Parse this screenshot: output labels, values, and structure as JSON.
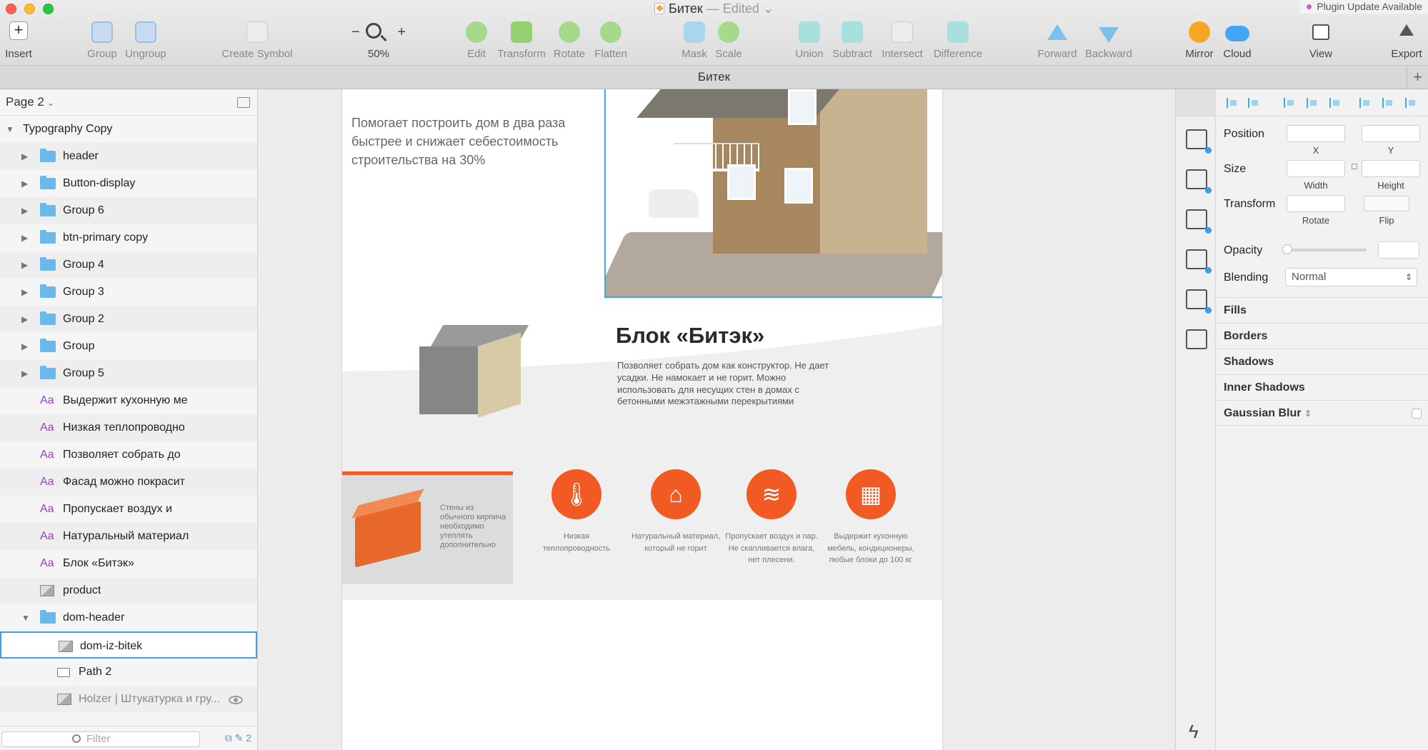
{
  "window": {
    "doc_name": "Битек",
    "doc_status": "— Edited",
    "plugin_badge": "Plugin Update Available",
    "tab_title": "Битек",
    "tab_add": "+"
  },
  "toolbar": {
    "insert": "Insert",
    "group": "Group",
    "ungroup": "Ungroup",
    "create_symbol": "Create Symbol",
    "zoom_minus": "−",
    "zoom_plus": "+",
    "zoom_level": "50%",
    "edit": "Edit",
    "transform": "Transform",
    "rotate": "Rotate",
    "flatten": "Flatten",
    "mask": "Mask",
    "scale": "Scale",
    "union": "Union",
    "subtract": "Subtract",
    "intersect": "Intersect",
    "difference": "Difference",
    "forward": "Forward",
    "backward": "Backward",
    "mirror": "Mirror",
    "cloud": "Cloud",
    "view": "View",
    "export": "Export"
  },
  "layers": {
    "page": "Page 2",
    "root": "Typography Copy",
    "items": [
      {
        "type": "folder",
        "name": "header"
      },
      {
        "type": "folder",
        "name": "Button-display"
      },
      {
        "type": "folder",
        "name": "Group 6"
      },
      {
        "type": "folder",
        "name": "btn-primary copy"
      },
      {
        "type": "folder",
        "name": "Group 4"
      },
      {
        "type": "folder",
        "name": "Group 3"
      },
      {
        "type": "folder",
        "name": "Group 2"
      },
      {
        "type": "folder",
        "name": "Group"
      },
      {
        "type": "folder",
        "name": "Group 5"
      },
      {
        "type": "text",
        "name": "Выдержит кухонную ме"
      },
      {
        "type": "text",
        "name": "Низкая теплопроводно"
      },
      {
        "type": "text",
        "name": "Позволяет собрать до"
      },
      {
        "type": "text",
        "name": "Фасад можно покрасит"
      },
      {
        "type": "text",
        "name": "Пропускает воздух и"
      },
      {
        "type": "text",
        "name": "Натуральный материал"
      },
      {
        "type": "text",
        "name": "Блок «Битэк»"
      },
      {
        "type": "image",
        "name": "product"
      },
      {
        "type": "folder",
        "name": "dom-header"
      },
      {
        "type": "image",
        "name": "dom-iz-bitek"
      },
      {
        "type": "shape",
        "name": "Path 2"
      },
      {
        "type": "image",
        "name": "Holzer | Штукатурка и гру..."
      }
    ],
    "filter_placeholder": "Filter",
    "filter_count": "2"
  },
  "canvas": {
    "hero_text": "Помогает построить дом в два раза быстрее и снижает себестоимость строительства на 30%",
    "block_title": "Блок «Битэк»",
    "block_desc": "Позволяет собрать дом как конструктор. Не дает усадки. Не намокает и не горит. Можно использовать для несущих стен в домах с бетонными межэтажными перекрытиями",
    "brick_text": "Стены из обычного кирпича необходимо утеплять дополнительно",
    "accent_color": "#f15a22",
    "features": [
      {
        "icon": "thermometer-icon",
        "text": "Низкая теплопроводность"
      },
      {
        "icon": "house-icon",
        "text": "Натуральный материал, который не горит"
      },
      {
        "icon": "air-waves-icon",
        "text": "Пропускает воздух и пар. Не скапливается влага, нет плесени."
      },
      {
        "icon": "brick-wall-check-icon",
        "text": "Выдержит кухонную мебель, кондиционеры, любые блоки до 100 кг."
      }
    ]
  },
  "inspector": {
    "position": "Position",
    "x": "X",
    "y": "Y",
    "size": "Size",
    "width": "Width",
    "height": "Height",
    "transform": "Transform",
    "rotate": "Rotate",
    "flip": "Flip",
    "opacity": "Opacity",
    "blending": "Blending",
    "blending_value": "Normal",
    "fills": "Fills",
    "borders": "Borders",
    "shadows": "Shadows",
    "inner_shadows": "Inner Shadows",
    "gaussian_blur": "Gaussian Blur"
  }
}
